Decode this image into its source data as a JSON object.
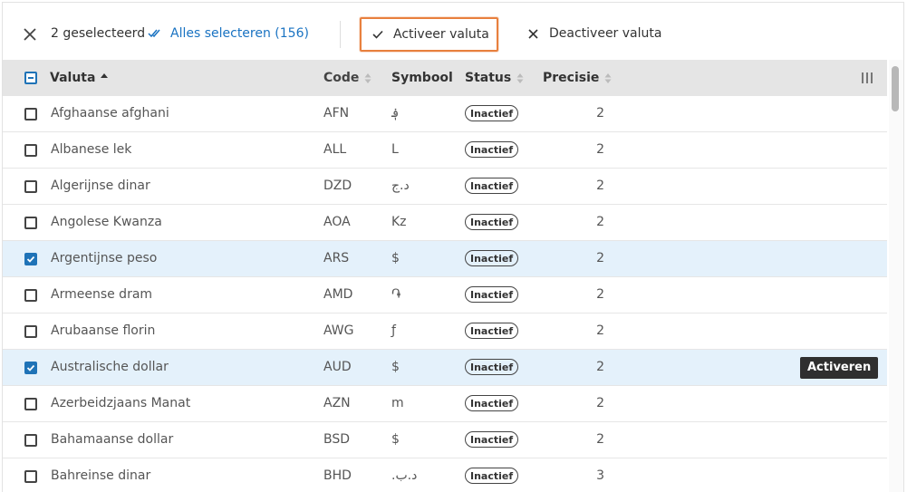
{
  "toolbar": {
    "selected_count": "2 geselecteerd",
    "select_all": "Alles selecteren (156)",
    "activate": "Activeer valuta",
    "deactivate": "Deactiveer valuta"
  },
  "table": {
    "headers": {
      "name": "Valuta",
      "code": "Code",
      "symbol": "Symbool",
      "status": "Status",
      "precision": "Precisie"
    },
    "rows": [
      {
        "name": "Afghaanse afghani",
        "code": "AFN",
        "symbol": "؋",
        "status": "Inactief",
        "precision": "2",
        "checked": false
      },
      {
        "name": "Albanese lek",
        "code": "ALL",
        "symbol": "L",
        "status": "Inactief",
        "precision": "2",
        "checked": false
      },
      {
        "name": "Algerijnse dinar",
        "code": "DZD",
        "symbol": "د.ج",
        "status": "Inactief",
        "precision": "2",
        "checked": false
      },
      {
        "name": "Angolese Kwanza",
        "code": "AOA",
        "symbol": "Kz",
        "status": "Inactief",
        "precision": "2",
        "checked": false
      },
      {
        "name": "Argentijnse peso",
        "code": "ARS",
        "symbol": "$",
        "status": "Inactief",
        "precision": "2",
        "checked": true
      },
      {
        "name": "Armeense dram",
        "code": "AMD",
        "symbol": "֏",
        "status": "Inactief",
        "precision": "2",
        "checked": false
      },
      {
        "name": "Arubaanse florin",
        "code": "AWG",
        "symbol": "ƒ",
        "status": "Inactief",
        "precision": "2",
        "checked": false
      },
      {
        "name": "Australische dollar",
        "code": "AUD",
        "symbol": "$",
        "status": "Inactief",
        "precision": "2",
        "checked": true
      },
      {
        "name": "Azerbeidzjaans Manat",
        "code": "AZN",
        "symbol": "m",
        "status": "Inactief",
        "precision": "2",
        "checked": false
      },
      {
        "name": "Bahamaanse dollar",
        "code": "BSD",
        "symbol": "$",
        "status": "Inactief",
        "precision": "2",
        "checked": false
      },
      {
        "name": "Bahreinse dinar",
        "code": "BHD",
        "symbol": ".د.ب",
        "status": "Inactief",
        "precision": "3",
        "checked": false
      }
    ],
    "tooltip": "Activeren"
  },
  "colors": {
    "accent": "#1f73b7",
    "highlight": "#e8803e",
    "selected_row": "#e4f1fb",
    "header": "#e5e5e5"
  }
}
